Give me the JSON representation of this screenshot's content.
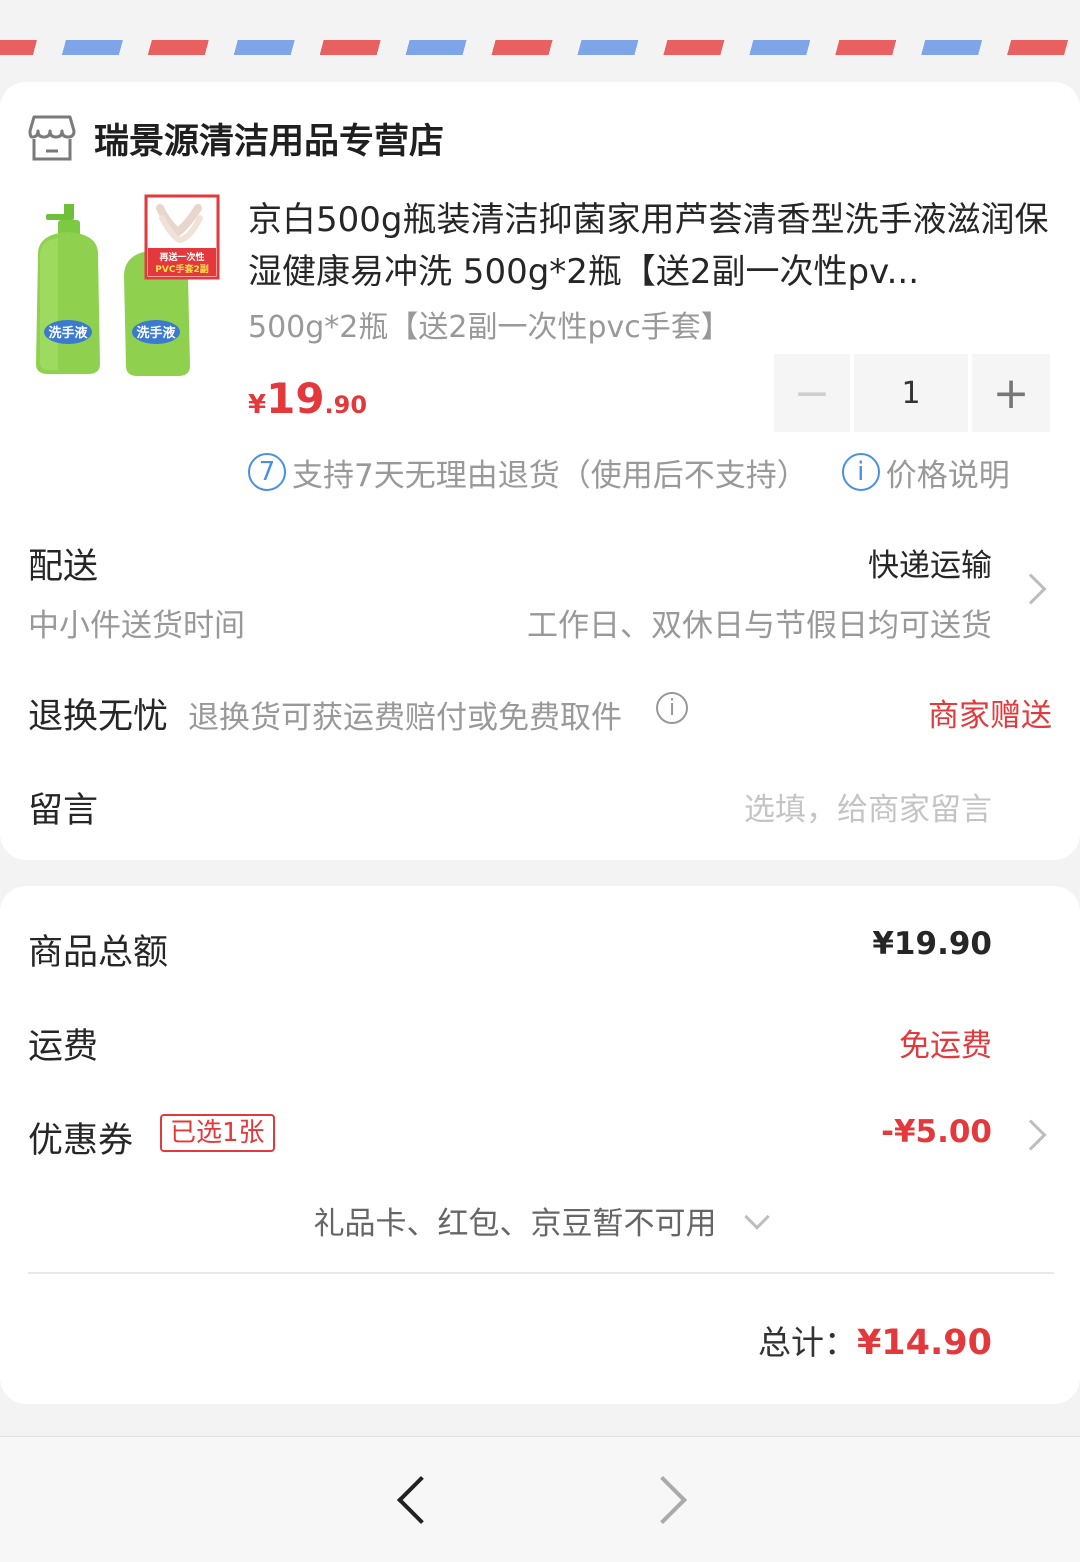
{
  "store": {
    "name": "瑞景源清洁用品专营店",
    "icon": "store-icon"
  },
  "product": {
    "title": "京白500g瓶装清洁抑菌家用芦荟清香型洗手液滋润保湿健康易冲洗 500g*2瓶【送2副一次性pv...",
    "sku": "500g*2瓶【送2副一次性pvc手套】",
    "price_currency": "¥",
    "price_int": "19",
    "price_dec": ".90",
    "image_badge": "再送一次性 PVC手套2副",
    "image_bottle_label": "洗手液",
    "quantity": "1",
    "minus": "−",
    "plus": "+",
    "service_badge": "7",
    "service_text": "支持7天无理由退货（使用后不支持）",
    "price_info_icon": "i",
    "price_info": "价格说明"
  },
  "delivery": {
    "label": "配送",
    "method": "快递运输",
    "time_label": "中小件送货时间",
    "time_value": "工作日、双休日与节假日均可送货"
  },
  "returns": {
    "label": "退换无忧",
    "desc": "退换货可获运费赔付或免费取件",
    "value": "商家赠送"
  },
  "message": {
    "label": "留言",
    "placeholder": "选填，给商家留言"
  },
  "summary": {
    "goods_label": "商品总额",
    "goods_value": "¥19.90",
    "shipping_label": "运费",
    "shipping_value": "免运费",
    "coupon_label": "优惠券",
    "coupon_tag": "已选1张",
    "coupon_value": "-¥5.00",
    "unavailable": "礼品卡、红包、京豆暂不可用",
    "total_label": "总计：",
    "total_value": "¥14.90"
  },
  "colors": {
    "accent": "#e4393c",
    "info_blue": "#4a90e2"
  }
}
